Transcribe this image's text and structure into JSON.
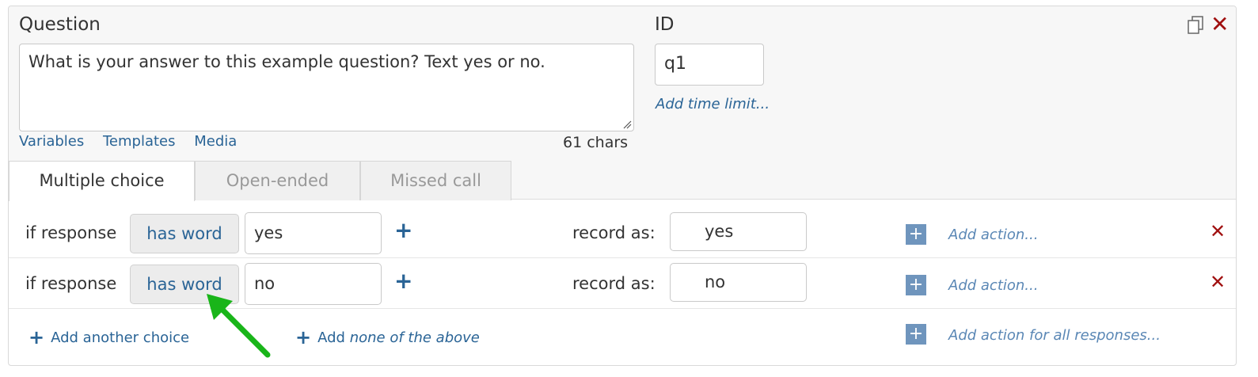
{
  "question": {
    "label": "Question",
    "text": "What is your answer to this example question? Text yes or no.",
    "links": [
      "Variables",
      "Templates",
      "Media"
    ],
    "char_count": "61 chars"
  },
  "id_field": {
    "label": "ID",
    "value": "q1",
    "add_time_limit": "Add time limit..."
  },
  "tabs": [
    {
      "label": "Multiple choice",
      "active": true
    },
    {
      "label": "Open-ended",
      "active": false
    },
    {
      "label": "Missed call",
      "active": false
    }
  ],
  "choices": [
    {
      "if_label": "if response",
      "match": "has word",
      "word": "yes",
      "record_label": "record as:",
      "record_value": "yes",
      "action": "Add action..."
    },
    {
      "if_label": "if response",
      "match": "has word",
      "word": "no",
      "record_label": "record as:",
      "record_value": "no",
      "action": "Add action..."
    }
  ],
  "footer": {
    "add_choice": "Add another choice",
    "add_none_prefix": "Add",
    "add_none_italic": "none of the above",
    "add_action_all": "Add action for all responses..."
  },
  "icons": {
    "copy": "copy-icon",
    "close": "close-icon",
    "plus": "plus-icon",
    "resize": "resize-handle-icon",
    "annotation": "green-arrow-icon"
  },
  "colors": {
    "link": "#2a6496",
    "delete": "#a01010",
    "action_square": "#6f95bd",
    "arrow": "#19b519"
  }
}
